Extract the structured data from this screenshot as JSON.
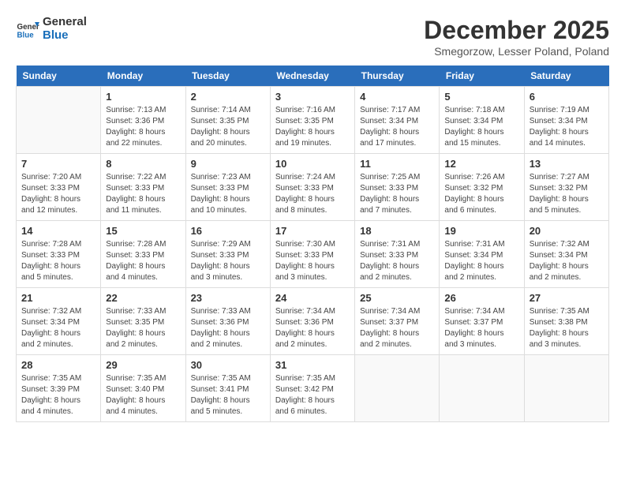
{
  "logo": {
    "line1": "General",
    "line2": "Blue"
  },
  "title": "December 2025",
  "subtitle": "Smegorzow, Lesser Poland, Poland",
  "days_header": [
    "Sunday",
    "Monday",
    "Tuesday",
    "Wednesday",
    "Thursday",
    "Friday",
    "Saturday"
  ],
  "weeks": [
    [
      {
        "day": "",
        "info": ""
      },
      {
        "day": "1",
        "info": "Sunrise: 7:13 AM\nSunset: 3:36 PM\nDaylight: 8 hours\nand 22 minutes."
      },
      {
        "day": "2",
        "info": "Sunrise: 7:14 AM\nSunset: 3:35 PM\nDaylight: 8 hours\nand 20 minutes."
      },
      {
        "day": "3",
        "info": "Sunrise: 7:16 AM\nSunset: 3:35 PM\nDaylight: 8 hours\nand 19 minutes."
      },
      {
        "day": "4",
        "info": "Sunrise: 7:17 AM\nSunset: 3:34 PM\nDaylight: 8 hours\nand 17 minutes."
      },
      {
        "day": "5",
        "info": "Sunrise: 7:18 AM\nSunset: 3:34 PM\nDaylight: 8 hours\nand 15 minutes."
      },
      {
        "day": "6",
        "info": "Sunrise: 7:19 AM\nSunset: 3:34 PM\nDaylight: 8 hours\nand 14 minutes."
      }
    ],
    [
      {
        "day": "7",
        "info": "Sunrise: 7:20 AM\nSunset: 3:33 PM\nDaylight: 8 hours\nand 12 minutes."
      },
      {
        "day": "8",
        "info": "Sunrise: 7:22 AM\nSunset: 3:33 PM\nDaylight: 8 hours\nand 11 minutes."
      },
      {
        "day": "9",
        "info": "Sunrise: 7:23 AM\nSunset: 3:33 PM\nDaylight: 8 hours\nand 10 minutes."
      },
      {
        "day": "10",
        "info": "Sunrise: 7:24 AM\nSunset: 3:33 PM\nDaylight: 8 hours\nand 8 minutes."
      },
      {
        "day": "11",
        "info": "Sunrise: 7:25 AM\nSunset: 3:33 PM\nDaylight: 8 hours\nand 7 minutes."
      },
      {
        "day": "12",
        "info": "Sunrise: 7:26 AM\nSunset: 3:32 PM\nDaylight: 8 hours\nand 6 minutes."
      },
      {
        "day": "13",
        "info": "Sunrise: 7:27 AM\nSunset: 3:32 PM\nDaylight: 8 hours\nand 5 minutes."
      }
    ],
    [
      {
        "day": "14",
        "info": "Sunrise: 7:28 AM\nSunset: 3:33 PM\nDaylight: 8 hours\nand 5 minutes."
      },
      {
        "day": "15",
        "info": "Sunrise: 7:28 AM\nSunset: 3:33 PM\nDaylight: 8 hours\nand 4 minutes."
      },
      {
        "day": "16",
        "info": "Sunrise: 7:29 AM\nSunset: 3:33 PM\nDaylight: 8 hours\nand 3 minutes."
      },
      {
        "day": "17",
        "info": "Sunrise: 7:30 AM\nSunset: 3:33 PM\nDaylight: 8 hours\nand 3 minutes."
      },
      {
        "day": "18",
        "info": "Sunrise: 7:31 AM\nSunset: 3:33 PM\nDaylight: 8 hours\nand 2 minutes."
      },
      {
        "day": "19",
        "info": "Sunrise: 7:31 AM\nSunset: 3:34 PM\nDaylight: 8 hours\nand 2 minutes."
      },
      {
        "day": "20",
        "info": "Sunrise: 7:32 AM\nSunset: 3:34 PM\nDaylight: 8 hours\nand 2 minutes."
      }
    ],
    [
      {
        "day": "21",
        "info": "Sunrise: 7:32 AM\nSunset: 3:34 PM\nDaylight: 8 hours\nand 2 minutes."
      },
      {
        "day": "22",
        "info": "Sunrise: 7:33 AM\nSunset: 3:35 PM\nDaylight: 8 hours\nand 2 minutes."
      },
      {
        "day": "23",
        "info": "Sunrise: 7:33 AM\nSunset: 3:36 PM\nDaylight: 8 hours\nand 2 minutes."
      },
      {
        "day": "24",
        "info": "Sunrise: 7:34 AM\nSunset: 3:36 PM\nDaylight: 8 hours\nand 2 minutes."
      },
      {
        "day": "25",
        "info": "Sunrise: 7:34 AM\nSunset: 3:37 PM\nDaylight: 8 hours\nand 2 minutes."
      },
      {
        "day": "26",
        "info": "Sunrise: 7:34 AM\nSunset: 3:37 PM\nDaylight: 8 hours\nand 3 minutes."
      },
      {
        "day": "27",
        "info": "Sunrise: 7:35 AM\nSunset: 3:38 PM\nDaylight: 8 hours\nand 3 minutes."
      }
    ],
    [
      {
        "day": "28",
        "info": "Sunrise: 7:35 AM\nSunset: 3:39 PM\nDaylight: 8 hours\nand 4 minutes."
      },
      {
        "day": "29",
        "info": "Sunrise: 7:35 AM\nSunset: 3:40 PM\nDaylight: 8 hours\nand 4 minutes."
      },
      {
        "day": "30",
        "info": "Sunrise: 7:35 AM\nSunset: 3:41 PM\nDaylight: 8 hours\nand 5 minutes."
      },
      {
        "day": "31",
        "info": "Sunrise: 7:35 AM\nSunset: 3:42 PM\nDaylight: 8 hours\nand 6 minutes."
      },
      {
        "day": "",
        "info": ""
      },
      {
        "day": "",
        "info": ""
      },
      {
        "day": "",
        "info": ""
      }
    ]
  ]
}
